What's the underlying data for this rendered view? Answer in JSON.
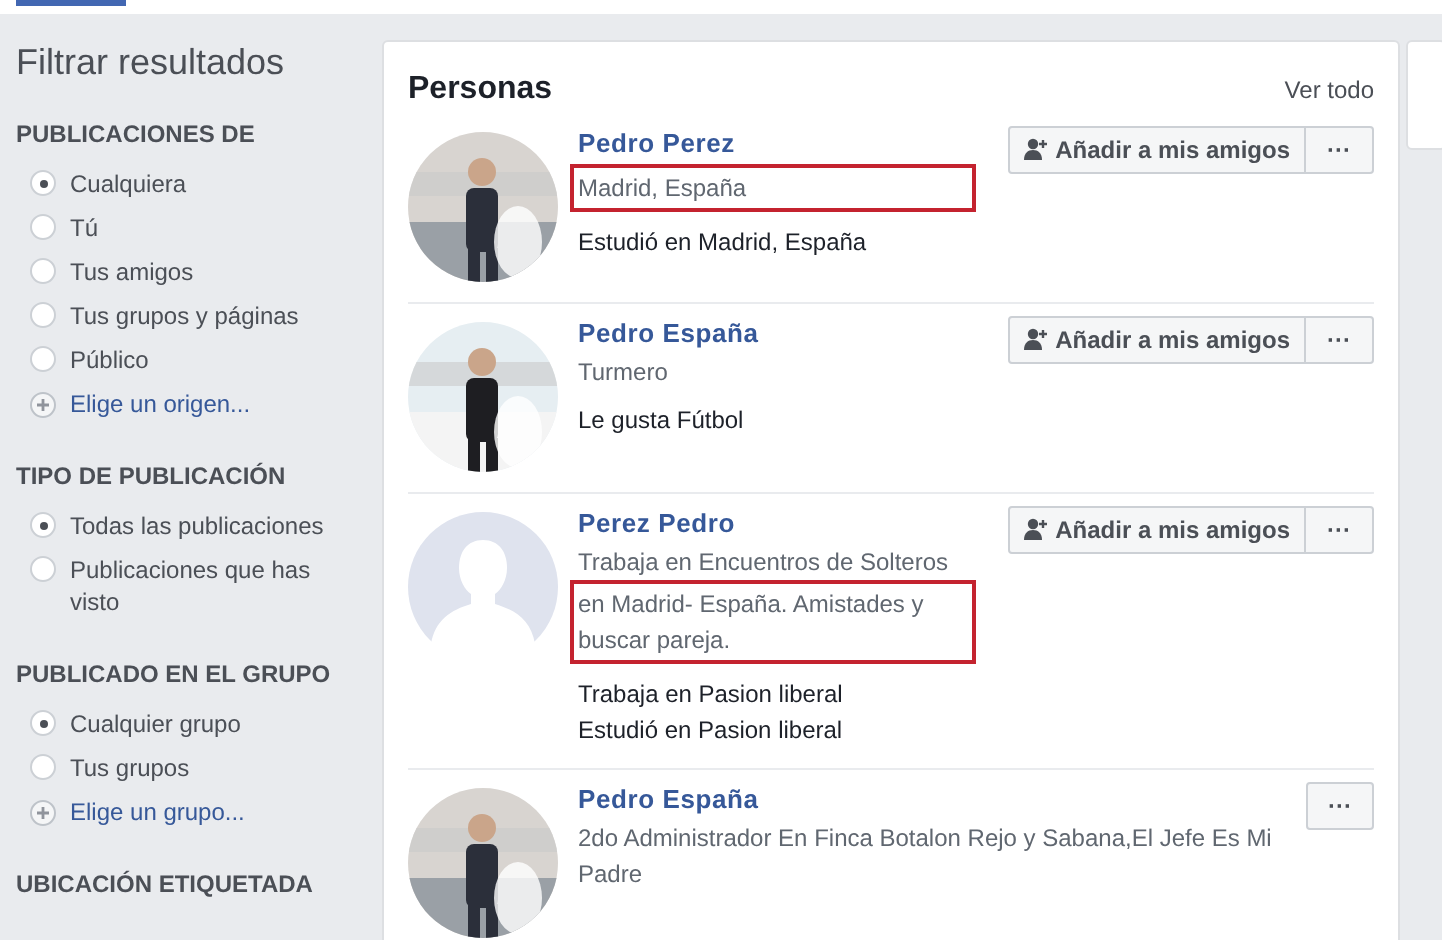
{
  "sidebar": {
    "title": "Filtrar resultados",
    "sections": [
      {
        "heading": "PUBLICACIONES DE",
        "options": [
          {
            "kind": "radio",
            "label": "Cualquiera",
            "selected": true
          },
          {
            "kind": "radio",
            "label": "Tú",
            "selected": false
          },
          {
            "kind": "radio",
            "label": "Tus amigos",
            "selected": false
          },
          {
            "kind": "radio",
            "label": "Tus grupos y páginas",
            "selected": false
          },
          {
            "kind": "radio",
            "label": "Público",
            "selected": false
          },
          {
            "kind": "add",
            "label": "Elige un origen..."
          }
        ]
      },
      {
        "heading": "TIPO DE PUBLICACIÓN",
        "options": [
          {
            "kind": "radio",
            "label": "Todas las publicaciones",
            "selected": true
          },
          {
            "kind": "radio",
            "label": "Publicaciones que has visto",
            "selected": false
          }
        ]
      },
      {
        "heading": "PUBLICADO EN EL GRUPO",
        "options": [
          {
            "kind": "radio",
            "label": "Cualquier grupo",
            "selected": true
          },
          {
            "kind": "radio",
            "label": "Tus grupos",
            "selected": false
          },
          {
            "kind": "add",
            "label": "Elige un grupo..."
          }
        ]
      },
      {
        "heading": "UBICACIÓN ETIQUETADA"
      }
    ]
  },
  "people": {
    "title": "Personas",
    "see_all": "Ver todo",
    "results": [
      {
        "name": "Pedro Perez",
        "kind": "picture",
        "subtitle": [
          {
            "text": "Madrid, España",
            "highlighted": true
          }
        ],
        "details": [
          "Estudió en Madrid, España"
        ],
        "add_button": "Añadir a mis amigos",
        "more": "···"
      },
      {
        "name": "Pedro España",
        "kind": "picture",
        "subtitle": [
          {
            "text": "Turmero",
            "highlighted": false
          }
        ],
        "details": [
          "Le gusta Fútbol"
        ],
        "add_button": "Añadir a mis amigos",
        "more": "···"
      },
      {
        "name": "Perez Pedro",
        "kind": "default_avatar",
        "subtitle": [
          {
            "text": "Trabaja en Encuentros de Solteros",
            "highlighted": false
          },
          {
            "text": "en Madrid- España. Amistades y buscar pareja.",
            "highlighted": true
          }
        ],
        "details": [
          "Trabaja en Pasion liberal",
          "Estudió en Pasion liberal"
        ],
        "add_button": "Añadir a mis amigos",
        "more": "···"
      },
      {
        "name": "Pedro España",
        "kind": "picture",
        "subtitle": [
          {
            "text": "2do Administrador En Finca Botalon Rejo y Sabana,El Jefe Es Mi Padre",
            "highlighted": false
          }
        ],
        "more": "···"
      }
    ]
  }
}
